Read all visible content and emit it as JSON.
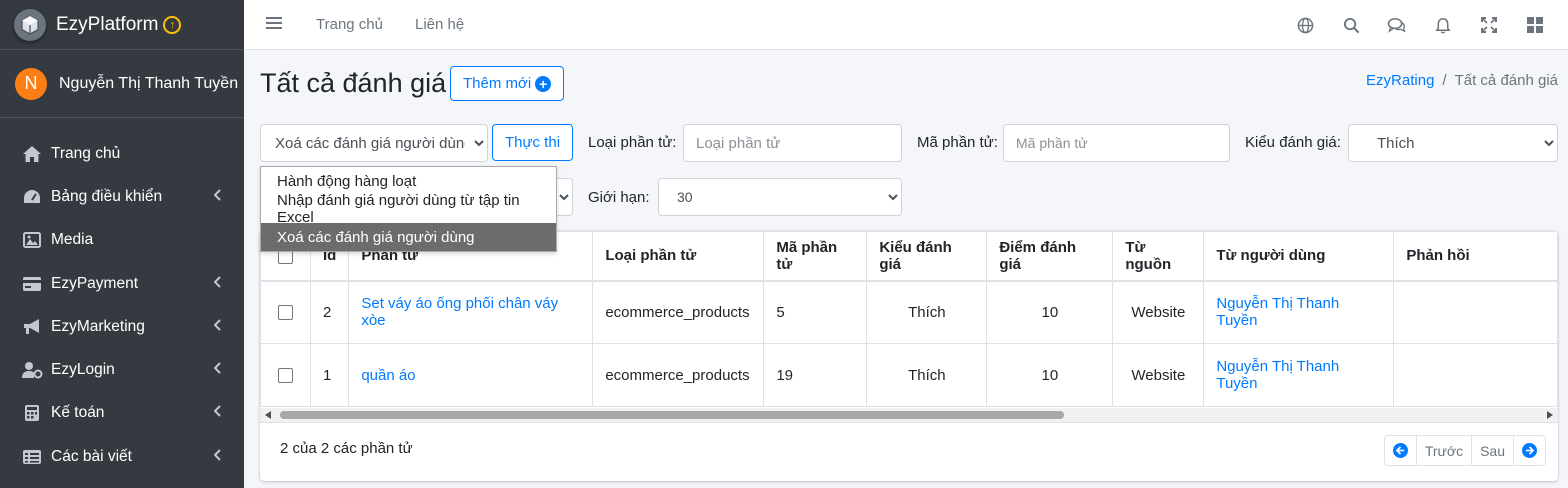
{
  "brand": {
    "name": "EzyPlatform"
  },
  "user": {
    "initial": "N",
    "name": "Nguyễn Thị Thanh Tuyền"
  },
  "sidebar": {
    "items": [
      {
        "label": "Trang chủ",
        "icon": "home-icon"
      },
      {
        "label": "Bảng điều khiển",
        "icon": "dashboard-icon"
      },
      {
        "label": "Media",
        "icon": "image-icon"
      },
      {
        "label": "EzyPayment",
        "icon": "credit-card-icon"
      },
      {
        "label": "EzyMarketing",
        "icon": "megaphone-icon"
      },
      {
        "label": "EzyLogin",
        "icon": "user-cog-icon"
      },
      {
        "label": "Kế toán",
        "icon": "calculator-icon"
      },
      {
        "label": "Các bài viết",
        "icon": "list-icon"
      }
    ]
  },
  "topbar": {
    "links": [
      "Trang chủ",
      "Liên hệ"
    ]
  },
  "page": {
    "title": "Tất cả đánh giá",
    "add_label": "Thêm mới"
  },
  "breadcrumb": {
    "parent": "EzyRating",
    "current": "Tất cả đánh giá"
  },
  "filters": {
    "bulk_selected": "Xoá các đánh giá người dùng",
    "exec_label": "Thực thi",
    "target_type_label": "Loại phần tử:",
    "target_type_placeholder": "Loại phần tử",
    "target_id_label": "Mã phần tử:",
    "target_id_placeholder": "Mã phần tử",
    "rating_type_label": "Kiểu đánh giá:",
    "rating_type_value": "Thích",
    "limit_label": "Giới hạn:",
    "limit_value": "30"
  },
  "bulk_options": [
    "Hành động hàng loạt",
    "Nhập đánh giá người dùng từ tập tin Excel",
    "Xoá các đánh giá người dùng"
  ],
  "table": {
    "headers": [
      "Id",
      "Phần tử",
      "Loại phần tử",
      "Mã phần tử",
      "Kiểu đánh giá",
      "Điểm đánh giá",
      "Từ nguồn",
      "Từ người dùng",
      "Phản hồi"
    ],
    "rows": [
      {
        "id": "2",
        "target": "Set váy áo ống phối chân váy xòe",
        "target_type": "ecommerce_products",
        "target_id": "5",
        "rating_type": "Thích",
        "score": "10",
        "source": "Website",
        "user": "Nguyễn Thị Thanh Tuyền",
        "reply": ""
      },
      {
        "id": "1",
        "target": "quần áo",
        "target_type": "ecommerce_products",
        "target_id": "19",
        "rating_type": "Thích",
        "score": "10",
        "source": "Website",
        "user": "Nguyễn Thị Thanh Tuyền",
        "reply": ""
      }
    ]
  },
  "footer": {
    "count_text": "2 của 2 các phần tử",
    "prev_label": "Trước",
    "next_label": "Sau"
  },
  "colors": {
    "sidebar_bg": "#343a40",
    "accent": "#007bff",
    "avatar": "#fd7e14",
    "brand_badge": "#ffc107"
  }
}
